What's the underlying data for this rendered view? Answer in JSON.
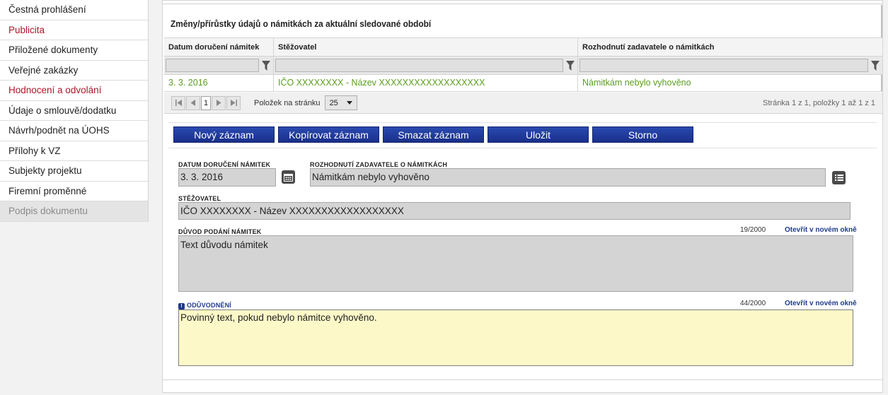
{
  "sidebar": {
    "items": [
      {
        "label": "Čestná prohlášení",
        "state": "normal"
      },
      {
        "label": "Publicita",
        "state": "red"
      },
      {
        "label": "Přiložené dokumenty",
        "state": "normal"
      },
      {
        "label": "Veřejné zakázky",
        "state": "normal"
      },
      {
        "label": "Hodnocení a odvolání",
        "state": "red"
      },
      {
        "label": "Údaje o smlouvě/dodatku",
        "state": "normal"
      },
      {
        "label": "Návrh/podnět na ÚOHS",
        "state": "normal"
      },
      {
        "label": "Přílohy k VZ",
        "state": "normal"
      },
      {
        "label": "Subjekty projektu",
        "state": "normal"
      },
      {
        "label": "Firemní proměnné",
        "state": "normal"
      },
      {
        "label": "Podpis dokumentu",
        "state": "disabled"
      }
    ]
  },
  "section": {
    "title": "Změny/přírůstky údajů o námitkách za aktuální sledované období"
  },
  "grid": {
    "columns": [
      "Datum doručení námitek",
      "Stěžovatel",
      "Rozhodnutí zadavatele o námitkách"
    ],
    "rows": [
      [
        "3. 3. 2016",
        "IČO XXXXXXXX - Název XXXXXXXXXXXXXXXXXX",
        "Námitkám nebylo vyhověno"
      ]
    ]
  },
  "pager": {
    "current_page": "1",
    "per_page_label": "Položek na stránku",
    "per_page_value": "25",
    "info": "Stránka 1 z 1, položky 1 až 1 z 1"
  },
  "toolbar": {
    "new": "Nový záznam",
    "copy": "Kopírovat záznam",
    "delete": "Smazat záznam",
    "save": "Uložit",
    "cancel": "Storno"
  },
  "form": {
    "date_label": "DATUM DORUČENÍ NÁMITEK",
    "date_value": "3. 3. 2016",
    "decision_label": "ROZHODNUTÍ ZADAVATELE O NÁMITKÁCH",
    "decision_value": "Námitkám nebylo vyhověno",
    "complainant_label": "STĚŽOVATEL",
    "complainant_value": "IČO XXXXXXXX - Název XXXXXXXXXXXXXXXXXX",
    "reason_label": "DŮVOD PODÁNÍ NÁMITEK",
    "reason_counter": "19/2000",
    "reason_link": "Otevřít v novém okně",
    "reason_value": "Text důvodu námitek",
    "justification_label": "ODŮVODNĚNÍ",
    "justification_counter": "44/2000",
    "justification_link": "Otevřít v novém okně",
    "justification_value": "Povinný text, pokud nebylo námitce vyhověno."
  },
  "icons": {
    "calendar": "calendar-icon",
    "list": "list-icon",
    "filter": "funnel-icon",
    "info": "info-icon"
  },
  "colors": {
    "accent_blue": "#1f3a8c",
    "red_text": "#b0142a",
    "green_text": "#5a9e1e",
    "required_bg": "#fcf8c8"
  }
}
